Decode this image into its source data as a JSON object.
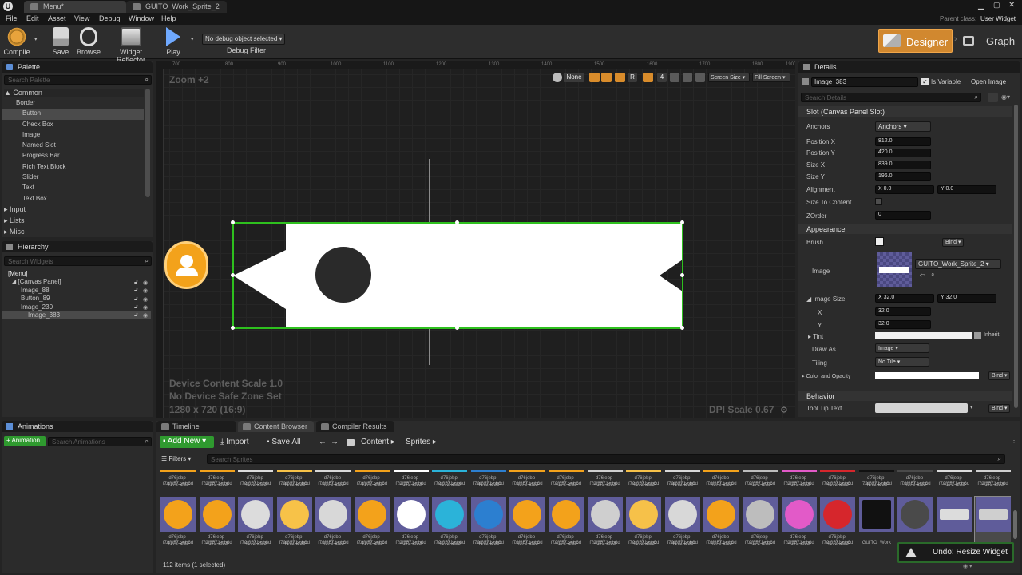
{
  "window": {
    "tabs": [
      {
        "label": "Menu*",
        "active": true
      },
      {
        "label": "GUITO_Work_Sprite_2",
        "active": false
      }
    ],
    "parent_class_label": "Parent class:",
    "parent_class_value": "User Widget"
  },
  "menu": [
    "File",
    "Edit",
    "Asset",
    "View",
    "Debug",
    "Window",
    "Help"
  ],
  "toolbar": {
    "compile": "Compile",
    "save": "Save",
    "browse": "Browse",
    "reflector": "Widget Reflector",
    "play": "Play",
    "debug_object": "No debug object selected",
    "debug_filter": "Debug Filter",
    "designer": "Designer",
    "graph": "Graph"
  },
  "palette": {
    "title": "Palette",
    "search_placeholder": "Search Palette",
    "category": "Common",
    "items": [
      "Border",
      "Button",
      "Check Box",
      "Image",
      "Named Slot",
      "Progress Bar",
      "Rich Text Block",
      "Slider",
      "Text",
      "Text Box"
    ],
    "collapsed": [
      "Input",
      "Lists",
      "Misc"
    ]
  },
  "hierarchy": {
    "title": "Hierarchy",
    "search_placeholder": "Search Widgets",
    "root": "[Menu]",
    "panel": "[Canvas Panel]",
    "children": [
      "Image_88",
      "Button_89",
      "Image_230",
      "Image_383"
    ]
  },
  "canvas": {
    "zoom": "Zoom +2",
    "ruler": [
      "700",
      "800",
      "900",
      "1000",
      "1100",
      "1200",
      "1300",
      "1400",
      "1500",
      "1600",
      "1700",
      "1800",
      "1900"
    ],
    "toolbar": {
      "none": "None",
      "r": "R",
      "four": "4",
      "screen_size": "Screen Size",
      "fill_screen": "Fill Screen"
    },
    "device_scale": "Device Content Scale 1.0",
    "safe_zone": "No Device Safe Zone Set",
    "resolution": "1280 x 720 (16:9)",
    "dpi": "DPI Scale 0.67"
  },
  "details": {
    "title": "Details",
    "widget_name": "Image_383",
    "is_variable": "Is Variable",
    "open_image": "Open Image",
    "search_placeholder": "Search Details",
    "slot_section": "Slot (Canvas Panel Slot)",
    "anchors_label": "Anchors",
    "anchors_value": "Anchors",
    "position_x_label": "Position X",
    "position_x": "812.0",
    "position_y_label": "Position Y",
    "position_y": "420.0",
    "size_x_label": "Size X",
    "size_x": "839.0",
    "size_y_label": "Size Y",
    "size_y": "196.0",
    "alignment_label": "Alignment",
    "alignment_x": "X 0.0",
    "alignment_y": "Y 0.0",
    "size_to_content": "Size To Content",
    "zorder_label": "ZOrder",
    "zorder": "0",
    "appearance": "Appearance",
    "brush": "Brush",
    "bind": "Bind",
    "image_label": "Image",
    "image_asset": "GUITO_Work_Sprite_2",
    "image_size": "Image Size",
    "image_size_x": "X 32.0",
    "image_size_y": "Y 32.0",
    "x_label": "X",
    "x_value": "32.0",
    "y_label": "Y",
    "y_value": "32.0",
    "tint": "Tint",
    "inherit": "Inherit",
    "draw_as": "Draw As",
    "draw_as_value": "Image",
    "tiling": "Tiling",
    "tiling_value": "No Tile",
    "color_opacity": "Color and Opacity",
    "behavior": "Behavior",
    "tooltip": "Tool Tip Text"
  },
  "bottom": {
    "animations_tab": "Animations",
    "add_animation": "Animation",
    "search_animations": "Search Animations",
    "tabs": [
      "Timeline",
      "Content Browser",
      "Compiler Results"
    ],
    "add_new": "Add New",
    "import": "Import",
    "save_all": "Save All",
    "path": [
      "Content",
      "Sprites"
    ],
    "filters": "Filters",
    "search_placeholder": "Search Sprites",
    "asset_label_1": "d76jebp-f70f3571-cb8d",
    "asset_label_2": "-4172-af33-",
    "last_asset_label": "GUITO_Work",
    "count": "112 items (1 selected)",
    "toast": "Undo: Resize Widget"
  }
}
